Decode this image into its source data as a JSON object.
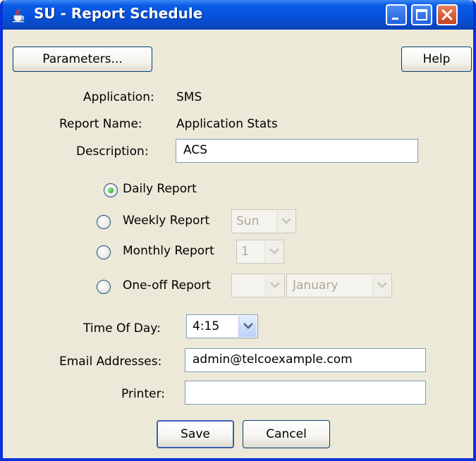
{
  "window": {
    "title": "SU - Report Schedule"
  },
  "toolbar": {
    "parameters_label": "Parameters...",
    "help_label": "Help"
  },
  "info": {
    "application_label": "Application:",
    "application_value": "SMS",
    "report_name_label": "Report Name:",
    "report_name_value": "Application Stats",
    "description_label": "Description:",
    "description_value": "ACS"
  },
  "schedule": {
    "selected": "daily",
    "daily_label": "Daily Report",
    "weekly_label": "Weekly Report",
    "weekly_day": "Sun",
    "monthly_label": "Monthly Report",
    "monthly_day": "1",
    "oneoff_label": "One-off Report",
    "oneoff_day": "",
    "oneoff_month": "January"
  },
  "time_of_day": {
    "label": "Time Of Day:",
    "value": "4:15"
  },
  "email": {
    "label": "Email Addresses:",
    "value": "admin@telcoexample.com"
  },
  "printer": {
    "label": "Printer:",
    "value": ""
  },
  "actions": {
    "save_label": "Save",
    "cancel_label": "Cancel"
  },
  "colors": {
    "titlebar": "#0a5ce6",
    "window_bg": "#ece9d8",
    "close_button": "#c8411e",
    "radio_selected": "#21a121"
  }
}
